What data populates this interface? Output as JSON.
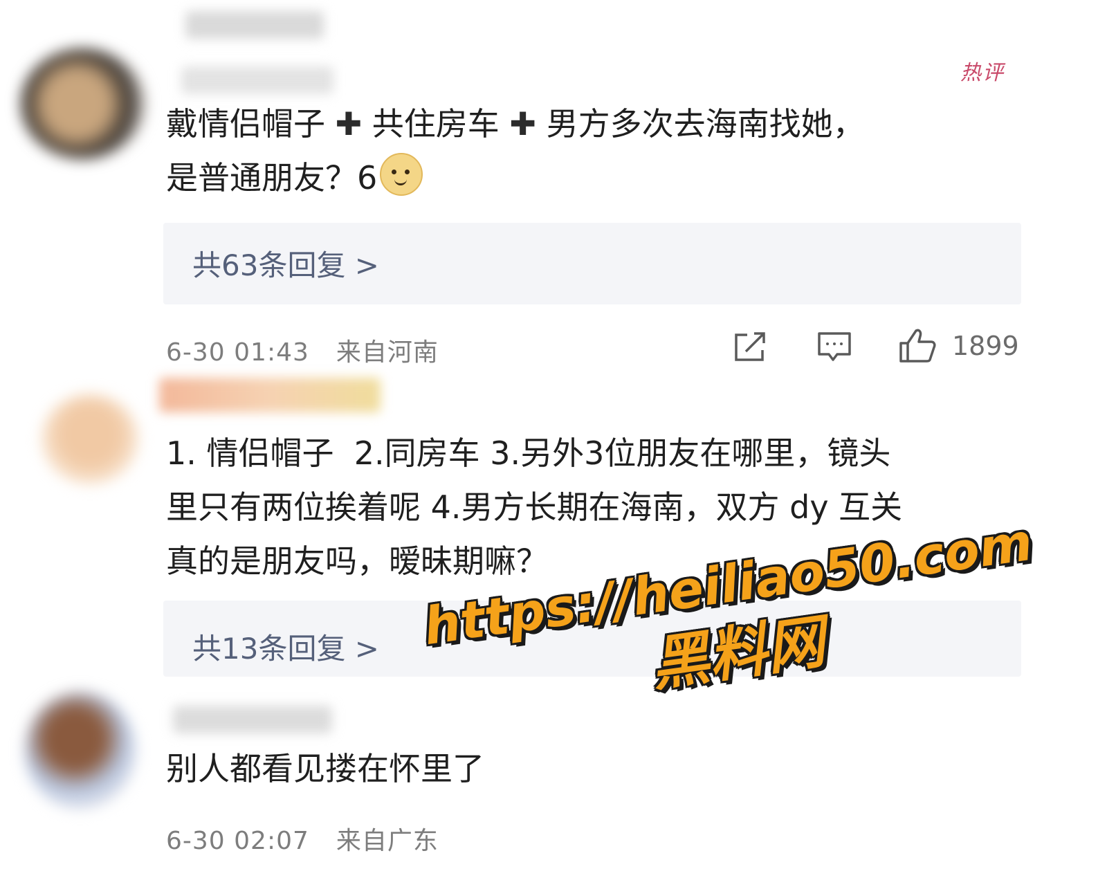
{
  "comments": [
    {
      "badge": "热评",
      "text_part1": "戴情侣帽子 ",
      "plus": "✚",
      "text_part2": " 共住房车 ",
      "text_part3": " 男方多次去海南找她，\n是普通朋友？6",
      "emoji": "doge-emoji",
      "replies_label": "共63条回复 >",
      "timestamp": "6-30 01:43",
      "location": "来自河南",
      "likes": "1899"
    },
    {
      "text": "1. 情侣帽子  2.同房车 3.另外3位朋友在哪里，镜头\n里只有两位挨着呢 4.男方长期在海南，双方 dy 互关\n真的是朋友吗，暧昧期嘛？",
      "replies_label": "共13条回复 >"
    },
    {
      "text": "别人都看见搂在怀里了",
      "timestamp": "6-30 02:07",
      "location": "来自广东"
    }
  ],
  "watermark": {
    "url": "https://heiliao50.com",
    "name": "黑料网"
  },
  "icons": {
    "share": "share-icon",
    "comment": "comment-icon",
    "like": "thumbs-up-icon"
  },
  "colors": {
    "background": "#ffffff",
    "reply_box": "#f4f5f8",
    "reply_text": "#55607a",
    "meta_text": "#7d7d7d",
    "hot_badge": "#c94a6a",
    "watermark": "#f5a21a"
  }
}
